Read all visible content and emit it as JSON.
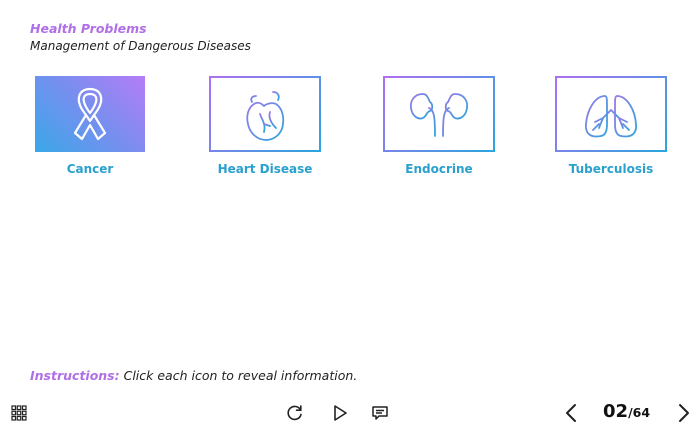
{
  "header": {
    "title": "Health Problems",
    "subtitle": "Management of Dangerous Diseases"
  },
  "cards": [
    {
      "label": "Cancer",
      "icon": "ribbon-icon",
      "active": true
    },
    {
      "label": "Heart Disease",
      "icon": "heart-icon",
      "active": false
    },
    {
      "label": "Endocrine",
      "icon": "kidneys-icon",
      "active": false
    },
    {
      "label": "Tuberculosis",
      "icon": "lungs-icon",
      "active": false
    }
  ],
  "instructions": {
    "lead": "Instructions:",
    "text": "Click each icon to reveal information."
  },
  "footer": {
    "current_page": "02",
    "total_pages": "/64",
    "icons": [
      "grid-menu-icon",
      "replay-icon",
      "play-icon",
      "captions-icon",
      "prev-icon",
      "next-icon"
    ]
  },
  "colors": {
    "accent_purple": "#b06fe6",
    "accent_blue": "#2aa0cf",
    "gradient_start": "#3aa7e8",
    "gradient_end": "#b57cf6"
  }
}
